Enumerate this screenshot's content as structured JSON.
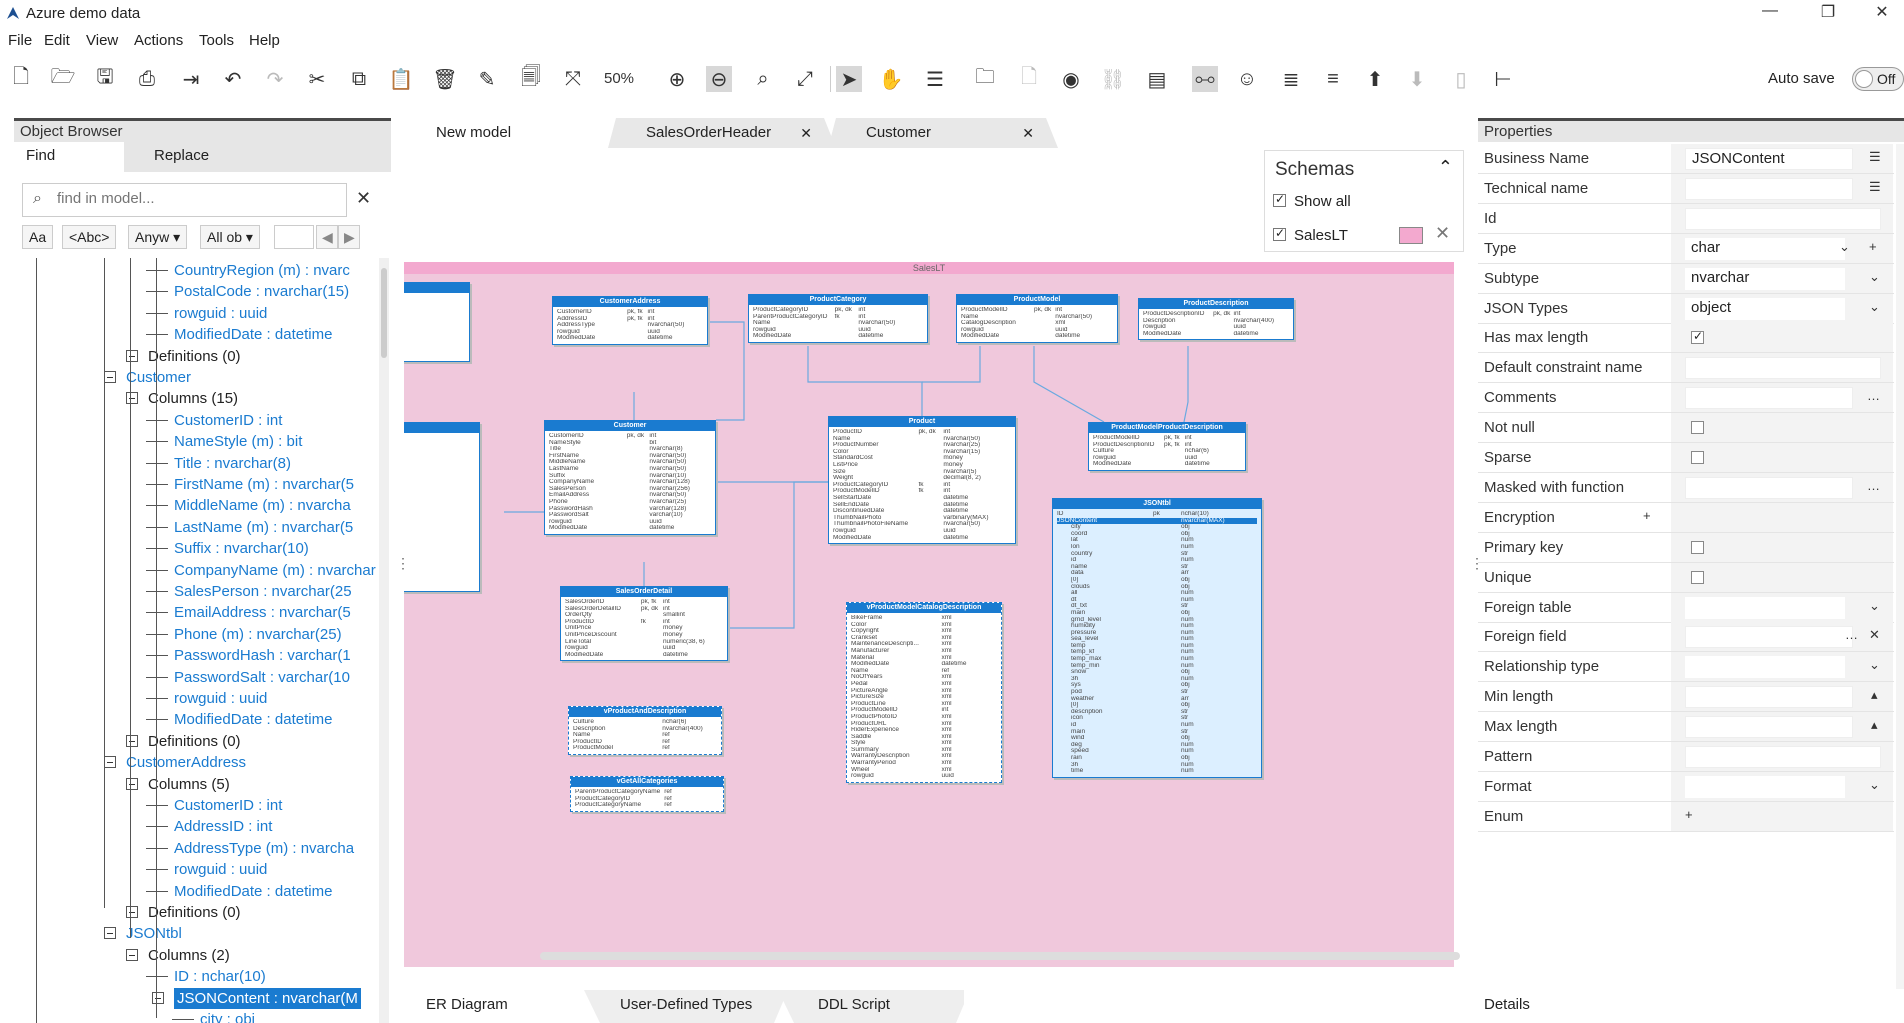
{
  "window": {
    "title": "Azure demo data",
    "controls": [
      "—",
      "❐",
      "✕"
    ]
  },
  "menu": [
    "File",
    "Edit",
    "View",
    "Actions",
    "Tools",
    "Help"
  ],
  "toolbar": {
    "zoom": "50%",
    "autosave_label": "Auto save",
    "autosave_state": "Off"
  },
  "object_browser": {
    "title": "Object Browser",
    "tabs": [
      "Find",
      "Replace"
    ],
    "search_placeholder": "find in model...",
    "filters": [
      "Aa",
      "<Abc>",
      "Anyw ▾",
      "All ob ▾"
    ],
    "tree": [
      {
        "text": "CountryRegion (m) : nvarc",
        "level": 3,
        "blue": true
      },
      {
        "text": "PostalCode : nvarchar(15)",
        "level": 3,
        "blue": true
      },
      {
        "text": "rowguid : uuid",
        "level": 3,
        "blue": true
      },
      {
        "text": "ModifiedDate : datetime",
        "level": 3,
        "blue": true
      },
      {
        "text": "Definitions (0)",
        "level": 2,
        "blue": false,
        "box": true
      },
      {
        "text": "Customer",
        "level": 1,
        "blue": true,
        "box": true
      },
      {
        "text": "Columns (15)",
        "level": 2,
        "blue": false,
        "box": true
      },
      {
        "text": "CustomerID : int",
        "level": 3,
        "blue": true
      },
      {
        "text": "NameStyle (m) : bit",
        "level": 3,
        "blue": true
      },
      {
        "text": "Title : nvarchar(8)",
        "level": 3,
        "blue": true
      },
      {
        "text": "FirstName (m) : nvarchar(5",
        "level": 3,
        "blue": true
      },
      {
        "text": "MiddleName (m) : nvarcha",
        "level": 3,
        "blue": true
      },
      {
        "text": "LastName (m) : nvarchar(5",
        "level": 3,
        "blue": true
      },
      {
        "text": "Suffix : nvarchar(10)",
        "level": 3,
        "blue": true
      },
      {
        "text": "CompanyName (m) : nvarchar",
        "level": 3,
        "blue": true
      },
      {
        "text": "SalesPerson : nvarchar(25",
        "level": 3,
        "blue": true
      },
      {
        "text": "EmailAddress : nvarchar(5",
        "level": 3,
        "blue": true
      },
      {
        "text": "Phone (m) : nvarchar(25)",
        "level": 3,
        "blue": true
      },
      {
        "text": "PasswordHash : varchar(1",
        "level": 3,
        "blue": true
      },
      {
        "text": "PasswordSalt : varchar(10",
        "level": 3,
        "blue": true
      },
      {
        "text": "rowguid : uuid",
        "level": 3,
        "blue": true
      },
      {
        "text": "ModifiedDate : datetime",
        "level": 3,
        "blue": true
      },
      {
        "text": "Definitions (0)",
        "level": 2,
        "blue": false,
        "box": true
      },
      {
        "text": "CustomerAddress",
        "level": 1,
        "blue": true,
        "box": true
      },
      {
        "text": "Columns (5)",
        "level": 2,
        "blue": false,
        "box": true
      },
      {
        "text": "CustomerID : int",
        "level": 3,
        "blue": true
      },
      {
        "text": "AddressID : int",
        "level": 3,
        "blue": true
      },
      {
        "text": "AddressType (m) : nvarcha",
        "level": 3,
        "blue": true
      },
      {
        "text": "rowguid : uuid",
        "level": 3,
        "blue": true
      },
      {
        "text": "ModifiedDate : datetime",
        "level": 3,
        "blue": true
      },
      {
        "text": "Definitions (0)",
        "level": 2,
        "blue": false,
        "box": true
      },
      {
        "text": "JSONtbl",
        "level": 1,
        "blue": true,
        "box": true
      },
      {
        "text": "Columns (2)",
        "level": 2,
        "blue": false,
        "box": true
      },
      {
        "text": "ID : nchar(10)",
        "level": 3,
        "blue": true
      },
      {
        "text": "JSONContent : nvarchar(M",
        "level": 3,
        "blue": true,
        "box": true,
        "selected": true
      },
      {
        "text": "city : obj",
        "level": 4,
        "blue": true
      }
    ]
  },
  "center": {
    "tabs": [
      "New model",
      "SalesOrderHeader",
      "Customer"
    ],
    "bottom_tabs": [
      "ER Diagram",
      "User-Defined Types",
      "DDL Script"
    ],
    "schemas": {
      "title": "Schemas",
      "show_all": "Show all",
      "items": [
        "SalesLT"
      ]
    },
    "schema_band_label": "SalesLT",
    "entities": [
      {
        "name": "CustomerAddress",
        "rows": [
          [
            "CustomerID",
            "pk, fk",
            "int"
          ],
          [
            "AddressID",
            "pk, fk",
            "int"
          ],
          [
            "AddressType",
            "",
            "nvarchar(50)"
          ],
          [
            "rowguid",
            "",
            "uuid"
          ],
          [
            "ModifiedDate",
            "",
            "datetime"
          ]
        ]
      },
      {
        "name": "ProductCategory",
        "rows": [
          [
            "ProductCategoryID",
            "pk, dk",
            "int"
          ],
          [
            "ParentProductCategoryID",
            "fk",
            "int"
          ],
          [
            "Name",
            "",
            "nvarchar(50)"
          ],
          [
            "rowguid",
            "",
            "uuid"
          ],
          [
            "ModifiedDate",
            "",
            "datetime"
          ]
        ]
      },
      {
        "name": "ProductModel",
        "rows": [
          [
            "ProductModelID",
            "pk, dk",
            "int"
          ],
          [
            "Name",
            "",
            "nvarchar(50)"
          ],
          [
            "CatalogDescription",
            "",
            "xml"
          ],
          [
            "rowguid",
            "",
            "uuid"
          ],
          [
            "ModifiedDate",
            "",
            "datetime"
          ]
        ]
      },
      {
        "name": "ProductDescription",
        "rows": [
          [
            "ProductDescriptionID",
            "pk, dk",
            "int"
          ],
          [
            "Description",
            "",
            "nvarchar(400)"
          ],
          [
            "rowguid",
            "",
            "uuid"
          ],
          [
            "ModifiedDate",
            "",
            "datetime"
          ]
        ]
      },
      {
        "name": "Customer",
        "rows": [
          [
            "CustomerID",
            "pk, dk",
            "int"
          ],
          [
            "NameStyle",
            "",
            "bit"
          ],
          [
            "Title",
            "",
            "nvarchar(8)"
          ],
          [
            "FirstName",
            "",
            "nvarchar(50)"
          ],
          [
            "MiddleName",
            "",
            "nvarchar(50)"
          ],
          [
            "LastName",
            "",
            "nvarchar(50)"
          ],
          [
            "Suffix",
            "",
            "nvarchar(10)"
          ],
          [
            "CompanyName",
            "",
            "nvarchar(128)"
          ],
          [
            "SalesPerson",
            "",
            "nvarchar(256)"
          ],
          [
            "EmailAddress",
            "",
            "nvarchar(50)"
          ],
          [
            "Phone",
            "",
            "nvarchar(25)"
          ],
          [
            "PasswordHash",
            "",
            "varchar(128)"
          ],
          [
            "PasswordSalt",
            "",
            "varchar(10)"
          ],
          [
            "rowguid",
            "",
            "uuid"
          ],
          [
            "ModifiedDate",
            "",
            "datetime"
          ]
        ]
      },
      {
        "name": "Product",
        "rows": [
          [
            "ProductID",
            "pk, dk",
            "int"
          ],
          [
            "Name",
            "",
            "nvarchar(50)"
          ],
          [
            "ProductNumber",
            "",
            "nvarchar(25)"
          ],
          [
            "Color",
            "",
            "nvarchar(15)"
          ],
          [
            "StandardCost",
            "",
            "money"
          ],
          [
            "ListPrice",
            "",
            "money"
          ],
          [
            "Size",
            "",
            "nvarchar(5)"
          ],
          [
            "Weight",
            "",
            "decimal(8, 2)"
          ],
          [
            "ProductCategoryID",
            "fk",
            "int"
          ],
          [
            "ProductModelID",
            "fk",
            "int"
          ],
          [
            "SellStartDate",
            "",
            "datetime"
          ],
          [
            "SellEndDate",
            "",
            "datetime"
          ],
          [
            "DiscontinuedDate",
            "",
            "datetime"
          ],
          [
            "ThumbNailPhoto",
            "",
            "varbinary(MAX)"
          ],
          [
            "ThumbnailPhotoFileName",
            "",
            "nvarchar(50)"
          ],
          [
            "rowguid",
            "",
            "uuid"
          ],
          [
            "ModifiedDate",
            "",
            "datetime"
          ]
        ]
      },
      {
        "name": "ProductModelProductDescription",
        "rows": [
          [
            "ProductModelID",
            "pk, fk",
            "int"
          ],
          [
            "ProductDescriptionID",
            "pk, fk",
            "int"
          ],
          [
            "Culture",
            "",
            "nchar(6)"
          ],
          [
            "rowguid",
            "",
            "uuid"
          ],
          [
            "ModifiedDate",
            "",
            "datetime"
          ]
        ]
      },
      {
        "name": "SalesOrderDetail",
        "rows": [
          [
            "SalesOrderID",
            "pk, fk",
            "int"
          ],
          [
            "SalesOrderDetailID",
            "pk, dk",
            "int"
          ],
          [
            "OrderQty",
            "",
            "smallint"
          ],
          [
            "ProductID",
            "fk",
            "int"
          ],
          [
            "UnitPrice",
            "",
            "money"
          ],
          [
            "UnitPriceDiscount",
            "",
            "money"
          ],
          [
            "LineTotal",
            "",
            "numeric(38, 6)"
          ],
          [
            "rowguid",
            "",
            "uuid"
          ],
          [
            "ModifiedDate",
            "",
            "datetime"
          ]
        ]
      },
      {
        "name": "vProductAndDescription",
        "rows": [
          [
            "Culture",
            "",
            "nchar(6)"
          ],
          [
            "Description",
            "",
            "nvarchar(400)"
          ],
          [
            "Name",
            "",
            "ref"
          ],
          [
            "ProductID",
            "",
            "ref"
          ],
          [
            "ProductModel",
            "",
            "ref"
          ]
        ]
      },
      {
        "name": "vGetAllCategories",
        "rows": [
          [
            "ParentProductCategoryName",
            "",
            "ref"
          ],
          [
            "ProductCategoryID",
            "",
            "ref"
          ],
          [
            "ProductCategoryName",
            "",
            "ref"
          ]
        ]
      },
      {
        "name": "vProductModelCatalogDescription",
        "rows": [
          [
            "BikeFrame",
            "",
            "xml"
          ],
          [
            "Color",
            "",
            "xml"
          ],
          [
            "Copyright",
            "",
            "xml"
          ],
          [
            "Crankset",
            "",
            "xml"
          ],
          [
            "MaintenanceDescripti...",
            "",
            "xml"
          ],
          [
            "Manufacturer",
            "",
            "xml"
          ],
          [
            "Material",
            "",
            "xml"
          ],
          [
            "ModifiedDate",
            "",
            "datetime"
          ],
          [
            "Name",
            "",
            "ref"
          ],
          [
            "NoOfYears",
            "",
            "xml"
          ],
          [
            "Pedal",
            "",
            "xml"
          ],
          [
            "PictureAngle",
            "",
            "xml"
          ],
          [
            "PictureSize",
            "",
            "xml"
          ],
          [
            "ProductLine",
            "",
            "xml"
          ],
          [
            "ProductModelID",
            "",
            "int"
          ],
          [
            "ProductPhotoID",
            "",
            "xml"
          ],
          [
            "ProductURL",
            "",
            "xml"
          ],
          [
            "RiderExperience",
            "",
            "xml"
          ],
          [
            "Saddle",
            "",
            "xml"
          ],
          [
            "Style",
            "",
            "xml"
          ],
          [
            "Summary",
            "",
            "xml"
          ],
          [
            "WarrantyDescription",
            "",
            "xml"
          ],
          [
            "WarrantyPeriod",
            "",
            "xml"
          ],
          [
            "Wheel",
            "",
            "xml"
          ],
          [
            "rowguid",
            "",
            "uuid"
          ]
        ]
      },
      {
        "name": "JSONtbl",
        "rows": [
          [
            "ID",
            "pk",
            "nchar(10)"
          ],
          [
            "JSONContent",
            "",
            "nvarchar(MAX)"
          ],
          [
            "city",
            "",
            "obj"
          ],
          [
            "coord",
            "",
            "obj"
          ],
          [
            "lat",
            "",
            "num"
          ],
          [
            "lon",
            "",
            "num"
          ],
          [
            "country",
            "",
            "str"
          ],
          [
            "id",
            "",
            "num"
          ],
          [
            "name",
            "",
            "str"
          ],
          [
            "data",
            "",
            "arr"
          ],
          [
            "[0]",
            "",
            "obj"
          ],
          [
            "clouds",
            "",
            "obj"
          ],
          [
            "all",
            "",
            "num"
          ],
          [
            "dt",
            "",
            "num"
          ],
          [
            "dt_txt",
            "",
            "str"
          ],
          [
            "main",
            "",
            "obj"
          ],
          [
            "grnd_level",
            "",
            "num"
          ],
          [
            "humidity",
            "",
            "num"
          ],
          [
            "pressure",
            "",
            "num"
          ],
          [
            "sea_level",
            "",
            "num"
          ],
          [
            "temp",
            "",
            "num"
          ],
          [
            "temp_kf",
            "",
            "num"
          ],
          [
            "temp_max",
            "",
            "num"
          ],
          [
            "temp_min",
            "",
            "num"
          ],
          [
            "snow",
            "",
            "obj"
          ],
          [
            "3h",
            "",
            "num"
          ],
          [
            "sys",
            "",
            "obj"
          ],
          [
            "pod",
            "",
            "str"
          ],
          [
            "weather",
            "",
            "arr"
          ],
          [
            "[0]",
            "",
            "obj"
          ],
          [
            "description",
            "",
            "str"
          ],
          [
            "icon",
            "",
            "str"
          ],
          [
            "id",
            "",
            "num"
          ],
          [
            "main",
            "",
            "str"
          ],
          [
            "wind",
            "",
            "obj"
          ],
          [
            "deg",
            "",
            "num"
          ],
          [
            "speed",
            "",
            "num"
          ],
          [
            "rain",
            "",
            "obj"
          ],
          [
            "3h",
            "",
            "num"
          ],
          [
            "time",
            "",
            "num"
          ]
        ]
      }
    ]
  },
  "properties": {
    "title": "Properties",
    "rows": [
      {
        "label": "Business Name",
        "value": "JSONContent",
        "kind": "text-btn"
      },
      {
        "label": "Technical name",
        "value": "",
        "kind": "text-btn"
      },
      {
        "label": "Id",
        "value": "",
        "kind": "text"
      },
      {
        "label": "Type",
        "value": "char",
        "kind": "select-plus"
      },
      {
        "label": "Subtype",
        "value": "nvarchar",
        "kind": "select"
      },
      {
        "label": "JSON Types",
        "value": "object",
        "kind": "select"
      },
      {
        "label": "Has max length",
        "value": "",
        "kind": "check-on"
      },
      {
        "label": "Default constraint name",
        "value": "",
        "kind": "text"
      },
      {
        "label": "Comments",
        "value": "",
        "kind": "dots"
      },
      {
        "label": "Not null",
        "value": "",
        "kind": "check"
      },
      {
        "label": "Sparse",
        "value": "",
        "kind": "check"
      },
      {
        "label": "Masked with function",
        "value": "",
        "kind": "dots"
      },
      {
        "label": "Encryption",
        "value": "",
        "kind": "plus-inline"
      },
      {
        "label": "Primary key",
        "value": "",
        "kind": "check"
      },
      {
        "label": "Unique",
        "value": "",
        "kind": "check"
      },
      {
        "label": "Foreign table",
        "value": "",
        "kind": "select"
      },
      {
        "label": "Foreign field",
        "value": "",
        "kind": "dots-x"
      },
      {
        "label": "Relationship type",
        "value": "",
        "kind": "select"
      },
      {
        "label": "Min length",
        "value": "",
        "kind": "spin"
      },
      {
        "label": "Max length",
        "value": "",
        "kind": "spin"
      },
      {
        "label": "Pattern",
        "value": "",
        "kind": "text"
      },
      {
        "label": "Format",
        "value": "",
        "kind": "select"
      },
      {
        "label": "Enum",
        "value": "",
        "kind": "plus"
      }
    ],
    "bottom_tab": "Details"
  }
}
